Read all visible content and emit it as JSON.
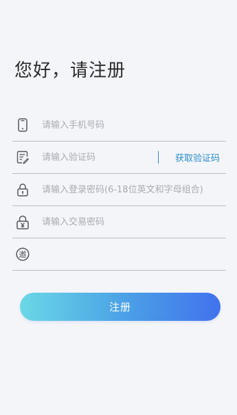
{
  "header": {
    "title": "您好，请注册"
  },
  "form": {
    "phone": {
      "icon": "phone-icon",
      "value": "",
      "placeholder": "请输入手机号码"
    },
    "code": {
      "icon": "message-edit-icon",
      "value": "",
      "placeholder": "请输入验证码",
      "get_code_label": "获取验证码"
    },
    "login_password": {
      "icon": "lock-icon",
      "value": "",
      "placeholder": "请输入登录密码(6-18位英文和字母组合)"
    },
    "trade_password": {
      "icon": "lock-yen-icon",
      "value": "",
      "placeholder": "请输入交易密码"
    },
    "invite_code": {
      "icon": "invite-icon",
      "icon_glyph": "邀",
      "value": "",
      "placeholder": ""
    }
  },
  "actions": {
    "register_label": "注册"
  },
  "colors": {
    "background": "#f4f5f9",
    "accent_link": "#2d8fc8",
    "button_gradient_start": "#6ad8e6",
    "button_gradient_end": "#4272ee",
    "divider": "#b9bcc6"
  }
}
